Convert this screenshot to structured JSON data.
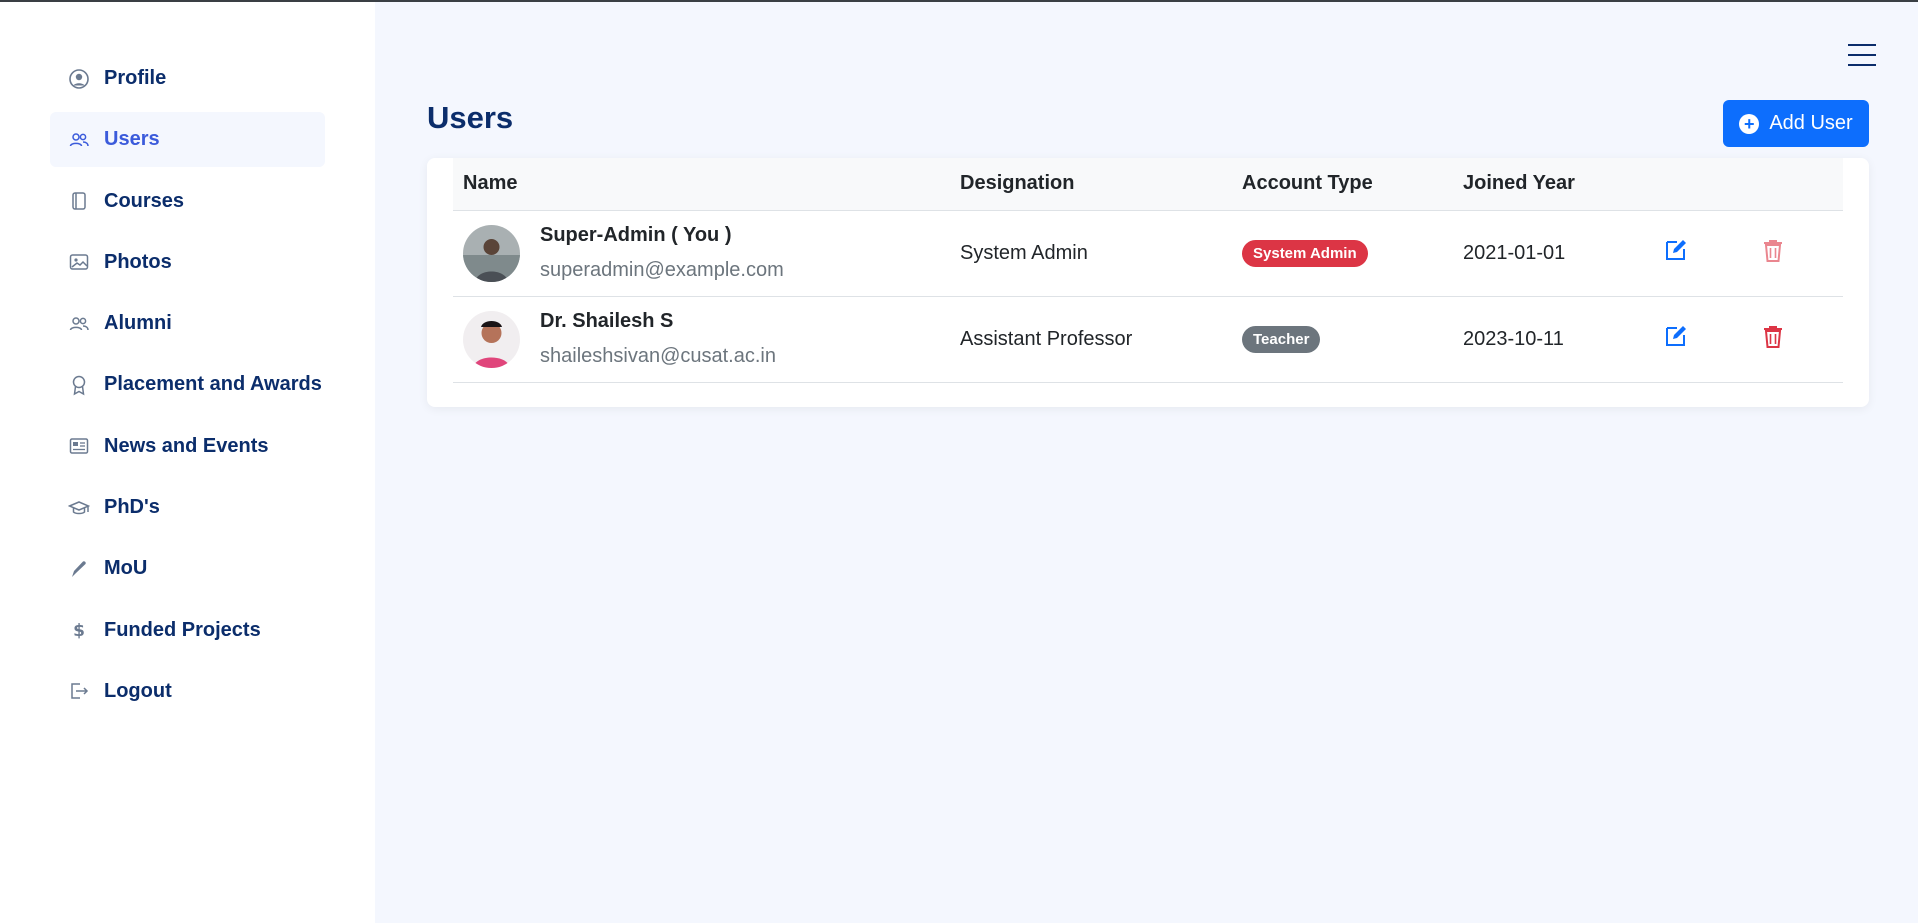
{
  "sidebar": {
    "items": [
      {
        "label": "Profile",
        "icon": "profile-icon",
        "active": false
      },
      {
        "label": "Users",
        "icon": "users-icon",
        "active": true
      },
      {
        "label": "Courses",
        "icon": "courses-icon",
        "active": false
      },
      {
        "label": "Photos",
        "icon": "photos-icon",
        "active": false
      },
      {
        "label": "Alumni",
        "icon": "alumni-icon",
        "active": false
      },
      {
        "label": "Placement and Awards",
        "icon": "award-icon",
        "active": false
      },
      {
        "label": "News and Events",
        "icon": "newspaper-icon",
        "active": false
      },
      {
        "label": "PhD's",
        "icon": "graduation-cap-icon",
        "active": false
      },
      {
        "label": "MoU",
        "icon": "pen-icon",
        "active": false
      },
      {
        "label": "Funded Projects",
        "icon": "dollar-icon",
        "active": false
      },
      {
        "label": "Logout",
        "icon": "logout-icon",
        "active": false
      }
    ]
  },
  "main": {
    "title": "Users",
    "add_button_label": "Add User",
    "table": {
      "headers": [
        "Name",
        "Designation",
        "Account Type",
        "Joined Year"
      ],
      "rows": [
        {
          "name": "Super-Admin ( You )",
          "email": "superadmin@example.com",
          "designation": "System Admin",
          "account_type": "System Admin",
          "account_color": "#dc3545",
          "joined": "2021-01-01"
        },
        {
          "name": "Dr. Shailesh S",
          "email": "shaileshsivan@cusat.ac.in",
          "designation": "Assistant Professor",
          "account_type": "Teacher",
          "account_color": "#6c757d",
          "joined": "2023-10-11"
        }
      ]
    }
  },
  "colors": {
    "primary": "#0d6efd",
    "nav_text": "#0b2d6b",
    "active_nav": "#3b5bdb",
    "danger": "#dc3545"
  }
}
